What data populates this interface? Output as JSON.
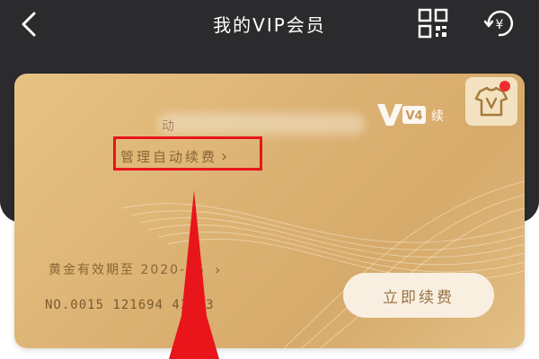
{
  "header": {
    "title": "我的VIP会员",
    "back_icon": "chevron-left-icon",
    "qr_icon": "qr-code-icon",
    "coin_icon": "yuan-refresh-icon"
  },
  "card": {
    "name_fragment": "动",
    "manage_label": "管理自动续费",
    "chevron": "›",
    "badge_text": "V4",
    "badge_suffix": "续",
    "expiry_text": "黄金有效期至 2020-05",
    "card_number": "NO.0015 121694 43013",
    "renew_label": "立即续费",
    "tag_icon": "shirt-v-icon",
    "notification_dot_color": "#f02b2b"
  },
  "annotation": {
    "highlight_color": "#e8151b",
    "arrow_color": "#e8151b"
  }
}
